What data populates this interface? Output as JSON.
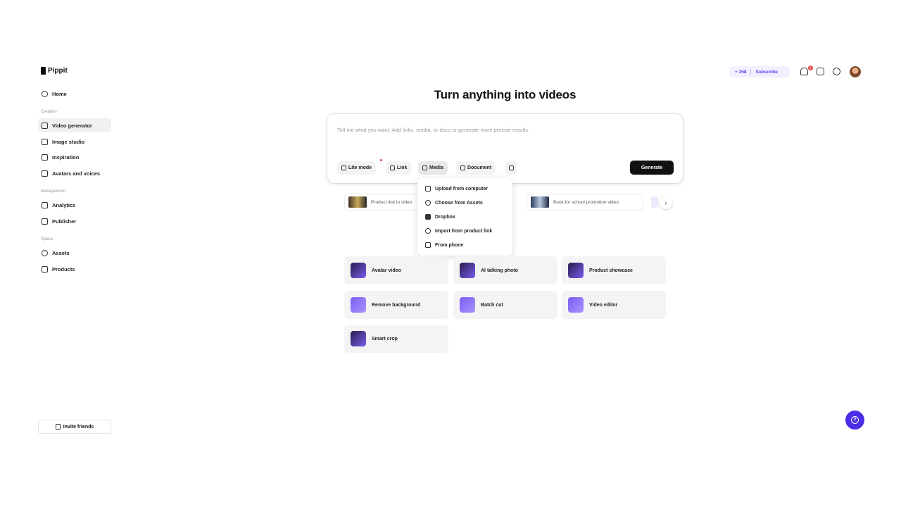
{
  "brand": {
    "name": "Pippit"
  },
  "sidebar": {
    "home": "Home",
    "sections": [
      {
        "label": "Creation",
        "items": [
          "Video generator",
          "Image studio",
          "Inspiration",
          "Avatars and voices"
        ]
      },
      {
        "label": "Management",
        "items": [
          "Analytics",
          "Publisher"
        ]
      },
      {
        "label": "Space",
        "items": [
          "Assets",
          "Products"
        ]
      }
    ],
    "active_item": "Video generator",
    "invite_label": "Invite friends"
  },
  "header": {
    "credits": "+ 358",
    "subscribe_label": "Subscribe",
    "notification_count": "1"
  },
  "main": {
    "headline": "Turn anything into videos",
    "prompt_placeholder": "Tell me what you want. Add links, media, or docs to generate more precise results.",
    "chips": [
      "Lite mode",
      "Link",
      "Media",
      "Document"
    ],
    "generate_label": "Generate",
    "suggestions": [
      "Product link to video",
      "Book for school promotion video"
    ],
    "media_menu": [
      "Upload from computer",
      "Choose from Assets",
      "Dropbox",
      "Import from product link",
      "From phone"
    ],
    "tools": [
      "Avatar video",
      "AI talking photo",
      "Product showcase",
      "Remove background",
      "Batch cut",
      "Video editor",
      "Smart crop"
    ]
  },
  "colors": {
    "accent": "#5b3df5",
    "help_button": "#4b2ee6",
    "primary_button": "#111111"
  }
}
